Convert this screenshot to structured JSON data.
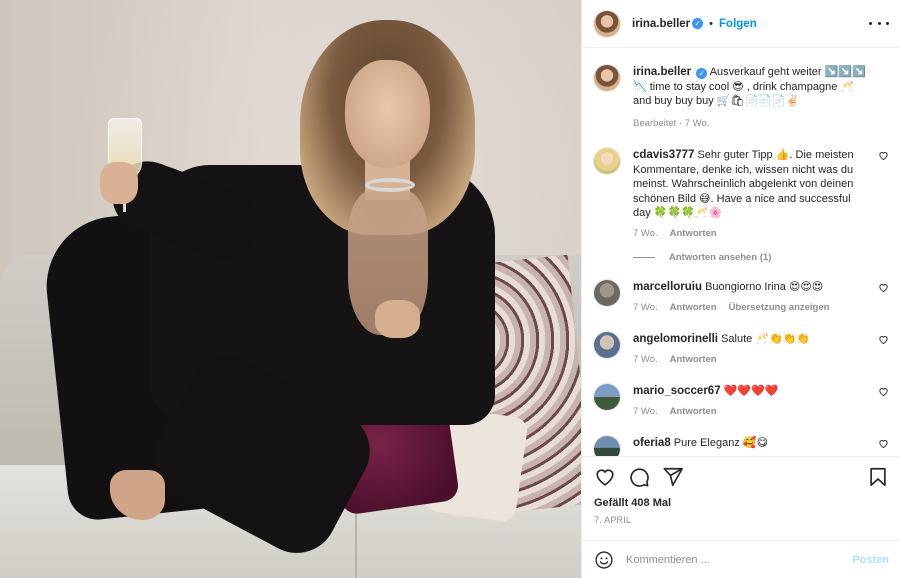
{
  "header": {
    "username": "irina.beller",
    "follow_label": "Folgen"
  },
  "caption": {
    "username": "irina.beller",
    "text": "Ausverkauf geht weiter ↘️↘️↘️ 📉 time to stay cool 😎 , drink champagne 🥂 and buy buy buy 🛒🛍📄📄📄✌🏻",
    "meta": "Bearbeitet · 7 Wo."
  },
  "comments": [
    {
      "username": "cdavis3777",
      "text": "Sehr guter Tipp 👍. Die meisten Kommentare, denke ich, wissen nicht was du meinst. Wahrscheinlich abgelenkt von deinen schönen Bild 😅. Have a nice and successful day 🍀🍀🍀🥂🌸",
      "time": "7 Wo.",
      "reply": "Antworten",
      "view_replies": "Antworten ansehen (1)"
    },
    {
      "username": "marcelloruiu",
      "text": "Buongiorno Irina 😍😍😍",
      "time": "7 Wo.",
      "reply": "Antworten",
      "translate": "Übersetzung anzeigen"
    },
    {
      "username": "angelomorinelli",
      "text": "Salute 🥂👏👏👏",
      "time": "7 Wo.",
      "reply": "Antworten"
    },
    {
      "username": "mario_soccer67",
      "text": "❤️❤️❤️❤️",
      "time": "7 Wo.",
      "reply": "Antworten"
    },
    {
      "username": "oferia8",
      "text": "Pure Eleganz 🥰😋"
    }
  ],
  "footer": {
    "likes": "Gefällt 408 Mal",
    "date": "7. April"
  },
  "composer": {
    "placeholder": "Kommentieren ...",
    "post_label": "Posten"
  },
  "colors": {
    "link": "#0095f6",
    "verified": "#3897f0",
    "post_disabled": "#b2dffc",
    "muted": "#8e8e8e"
  }
}
